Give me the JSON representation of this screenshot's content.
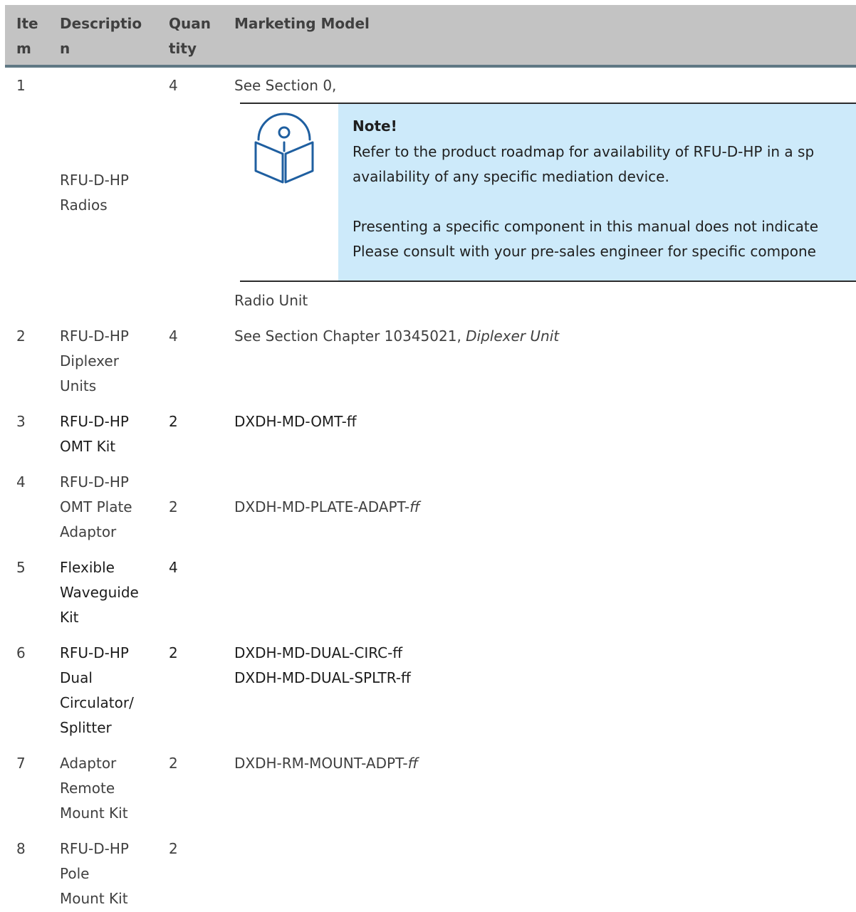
{
  "headers": {
    "item": [
      "Ite",
      "m"
    ],
    "description": [
      "Descriptio",
      "n"
    ],
    "quantity": [
      "Quan",
      "tity"
    ],
    "model": [
      "Marketing Model"
    ]
  },
  "rows": [
    {
      "item": "1",
      "description": [
        "RFU-D-HP",
        "Radios"
      ],
      "quantity": "4",
      "model_lines": [
        "See Section 0,"
      ],
      "model_after": "Radio Unit"
    },
    {
      "item": "2",
      "description": [
        "RFU-D-HP",
        "Diplexer",
        "Units"
      ],
      "quantity": "4",
      "model_prefix": "See Section Chapter 10345021, ",
      "model_italic": "Diplexer Unit"
    },
    {
      "item": "3",
      "description": [
        "RFU-D-HP",
        "OMT Kit"
      ],
      "quantity": "2",
      "model_lines": [
        "DXDH-MD-OMT-ff"
      ]
    },
    {
      "item": "4",
      "description": [
        "RFU-D-HP",
        "OMT Plate",
        "Adaptor"
      ],
      "quantity": "2",
      "model_prefix": "DXDH-MD-PLATE-ADAPT-",
      "model_italic": "ff"
    },
    {
      "item": "5",
      "description": [
        "Flexible",
        "Waveguide",
        "Kit"
      ],
      "quantity": "4",
      "model_lines": []
    },
    {
      "item": "6",
      "description": [
        "RFU-D-HP",
        "Dual",
        "Circulator/",
        "Splitter"
      ],
      "quantity": "2",
      "model_lines": [
        "DXDH-MD-DUAL-CIRC-ff",
        "DXDH-MD-DUAL-SPLTR-ff"
      ]
    },
    {
      "item": "7",
      "description": [
        "Adaptor",
        "Remote",
        "Mount Kit"
      ],
      "quantity": "2",
      "model_prefix": "DXDH-RM-MOUNT-ADPT-",
      "model_italic": "ff"
    },
    {
      "item": "8",
      "description": [
        "RFU-D-HP",
        "Pole",
        "Mount Kit"
      ],
      "quantity": "2",
      "model_lines": []
    }
  ],
  "note": {
    "icon": "book-info-icon",
    "title": "Note!",
    "lines": [
      "Refer to the product roadmap for availability of RFU-D-HP in a sp",
      "availability of any specific mediation device.",
      "",
      "Presenting a specific component in this manual does not indicate",
      "Please consult with your pre-sales engineer for specific compone"
    ]
  },
  "colors": {
    "header_bg": "#c3c3c3",
    "header_rule": "#5f7884",
    "note_bg": "#cdeafa",
    "icon_stroke": "#1f5fa0"
  }
}
